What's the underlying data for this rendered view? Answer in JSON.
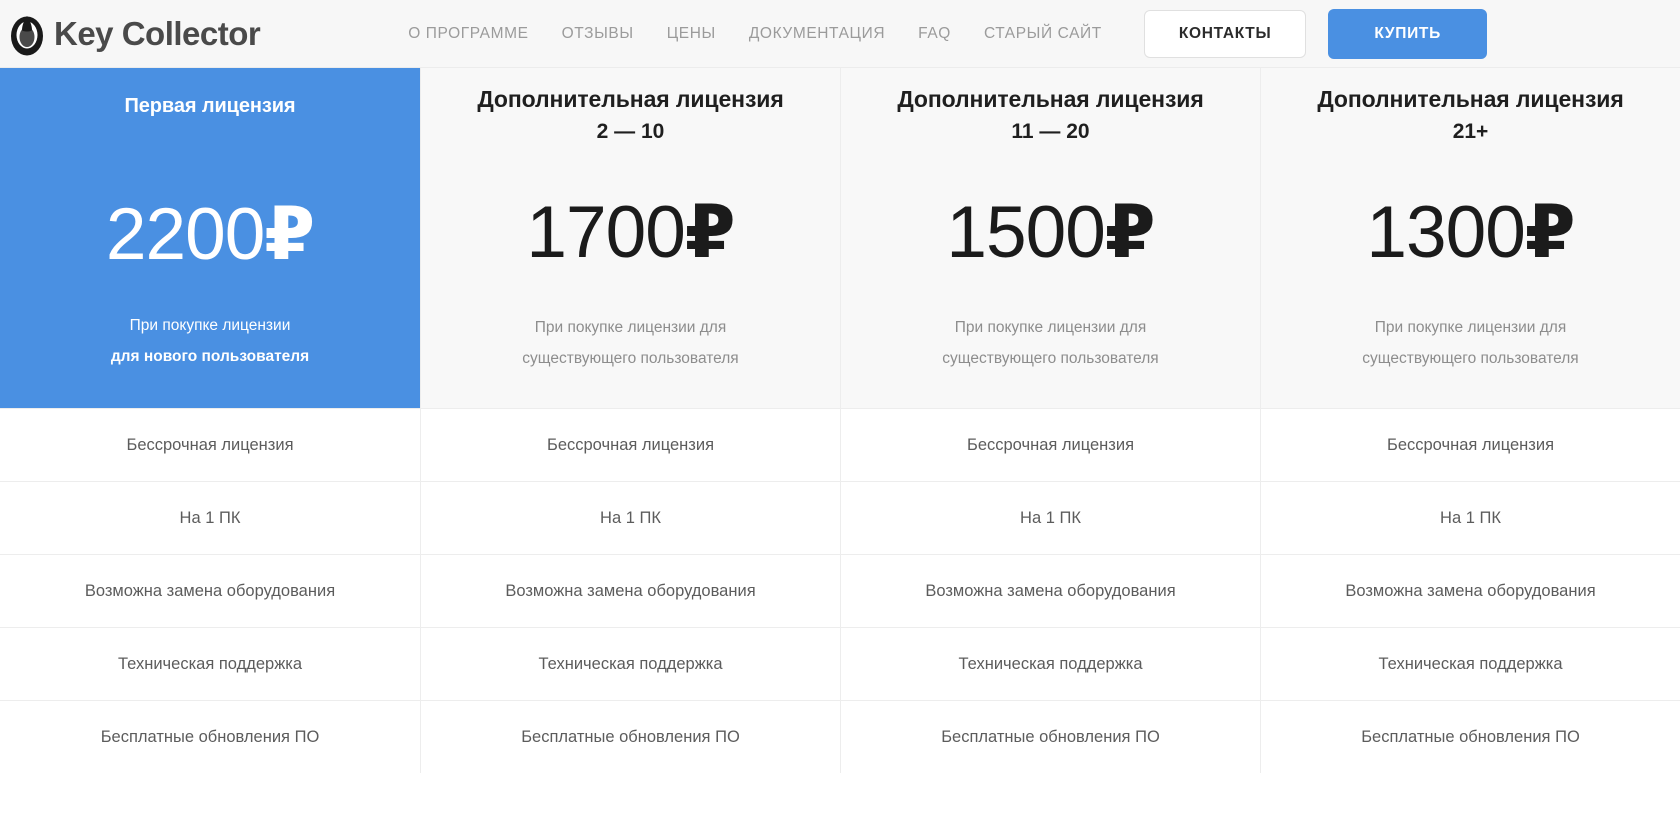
{
  "header": {
    "brand": "Key Collector",
    "logo_icon": "egg-logo-icon",
    "nav": [
      {
        "label": "О ПРОГРАММЕ"
      },
      {
        "label": "ОТЗЫВЫ"
      },
      {
        "label": "ЦЕНЫ"
      },
      {
        "label": "ДОКУМЕНТАЦИЯ"
      },
      {
        "label": "FAQ"
      },
      {
        "label": "СТАРЫЙ САЙТ"
      }
    ],
    "contacts_label": "КОНТАКТЫ",
    "buy_label": "КУПИТЬ"
  },
  "colors": {
    "accent_blue": "#4a90e2",
    "header_bg": "#f7f7f7",
    "plan_bg": "#f8f8f8",
    "divider": "#ededed",
    "title_text": "#1f1f1f",
    "muted_text": "#8d8d8d",
    "feature_text": "#5c5c5c",
    "nav_text": "#9b9b9b"
  },
  "plans": [
    {
      "title": "Первая лицензия",
      "range": "",
      "price": "2200",
      "currency": "₽",
      "note_line1": "При покупке лицензии",
      "note_line2": "для нового пользователя",
      "featured": true
    },
    {
      "title": "Дополнительная лицензия",
      "range": "2 — 10",
      "price": "1700",
      "currency": "₽",
      "note_line1": "При покупке лицензии для",
      "note_line2": "существующего пользователя",
      "featured": false
    },
    {
      "title": "Дополнительная лицензия",
      "range": "11 — 20",
      "price": "1500",
      "currency": "₽",
      "note_line1": "При покупке лицензии для",
      "note_line2": "существующего пользователя",
      "featured": false
    },
    {
      "title": "Дополнительная лицензия",
      "range": "21+",
      "price": "1300",
      "currency": "₽",
      "note_line1": "При покупке лицензии для",
      "note_line2": "существующего пользователя",
      "featured": false
    }
  ],
  "features": [
    "Бессрочная лицензия",
    "На 1 ПК",
    "Возможна замена оборудования",
    "Техническая поддержка",
    "Бесплатные обновления ПО"
  ]
}
